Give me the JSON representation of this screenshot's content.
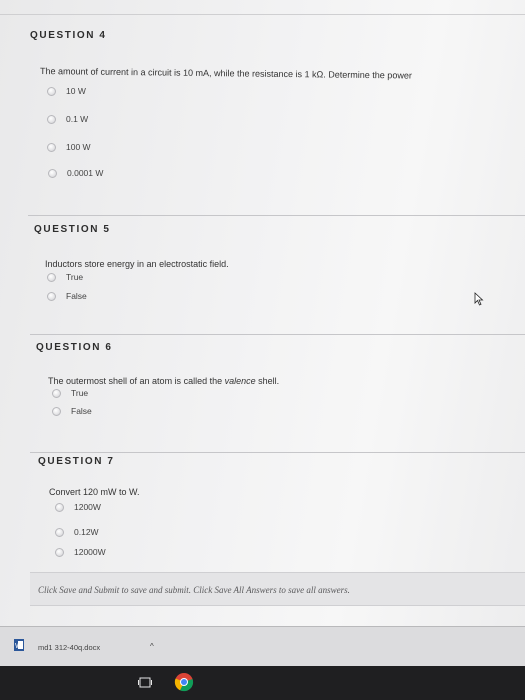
{
  "questions": [
    {
      "title": "QUESTION 4",
      "text": "The amount of current in a circuit is 10 mA, while the resistance is 1 kΩ. Determine the power",
      "options": [
        "10 W",
        "0.1 W",
        "100 W",
        "0.0001 W"
      ]
    },
    {
      "title": "QUESTION 5",
      "text": "Inductors store energy in an electrostatic field.",
      "options": [
        "True",
        "False"
      ]
    },
    {
      "title": "QUESTION 6",
      "text_before": "The outermost shell of an atom is called the ",
      "text_italic": "valence",
      "text_after": " shell.",
      "options": [
        "True",
        "False"
      ]
    },
    {
      "title": "QUESTION 7",
      "text": "Convert 120 mW to W.",
      "options": [
        "1200W",
        "0.12W",
        "12000W"
      ]
    }
  ],
  "submit_note": "Click Save and Submit to save and submit. Click Save All Answers to save all answers.",
  "download": {
    "file_name": "md1 312-40q.docx",
    "chevron": "^"
  },
  "icons": {
    "file": "word-document-icon",
    "cursor": "mouse-pointer-icon",
    "taskview": "task-view-icon",
    "browser": "chrome-icon"
  }
}
